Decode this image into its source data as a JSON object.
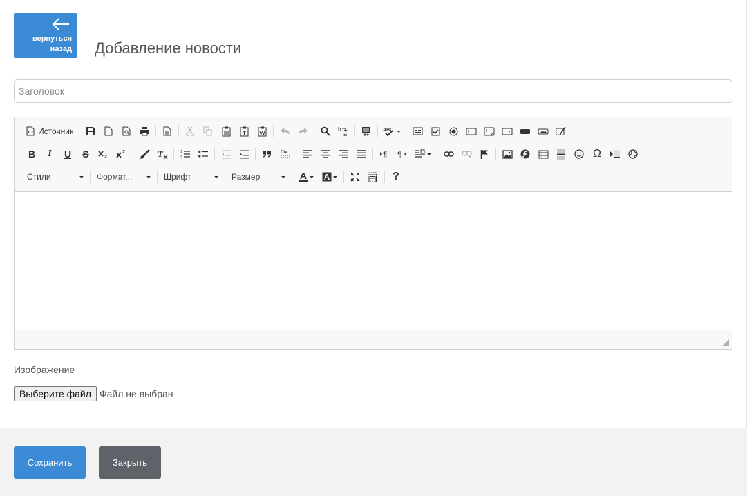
{
  "header": {
    "back_label_line1": "вернуться",
    "back_label_line2": "назад",
    "title": "Добавление новости"
  },
  "form": {
    "title_placeholder": "Заголовок",
    "title_value": "",
    "image_label": "Изображение",
    "file_button_label": "Выберите файл",
    "file_status": "Файл не выбран"
  },
  "editor": {
    "source_label": "Источник",
    "styles_label": "Стили",
    "format_label": "Формат...",
    "font_label": "Шрифт",
    "size_label": "Размер",
    "help_label": "?",
    "bold_glyph": "B",
    "italic_glyph": "I",
    "underline_glyph": "U",
    "strike_glyph": "S",
    "omega_glyph": "Ω"
  },
  "footer": {
    "save_label": "Сохранить",
    "close_label": "Закрыть"
  },
  "colors": {
    "primary": "#3a8ad6",
    "secondary": "#5d6369",
    "footer_bg": "#f2f2f2",
    "toolbar_bg": "#f8f8f8"
  }
}
